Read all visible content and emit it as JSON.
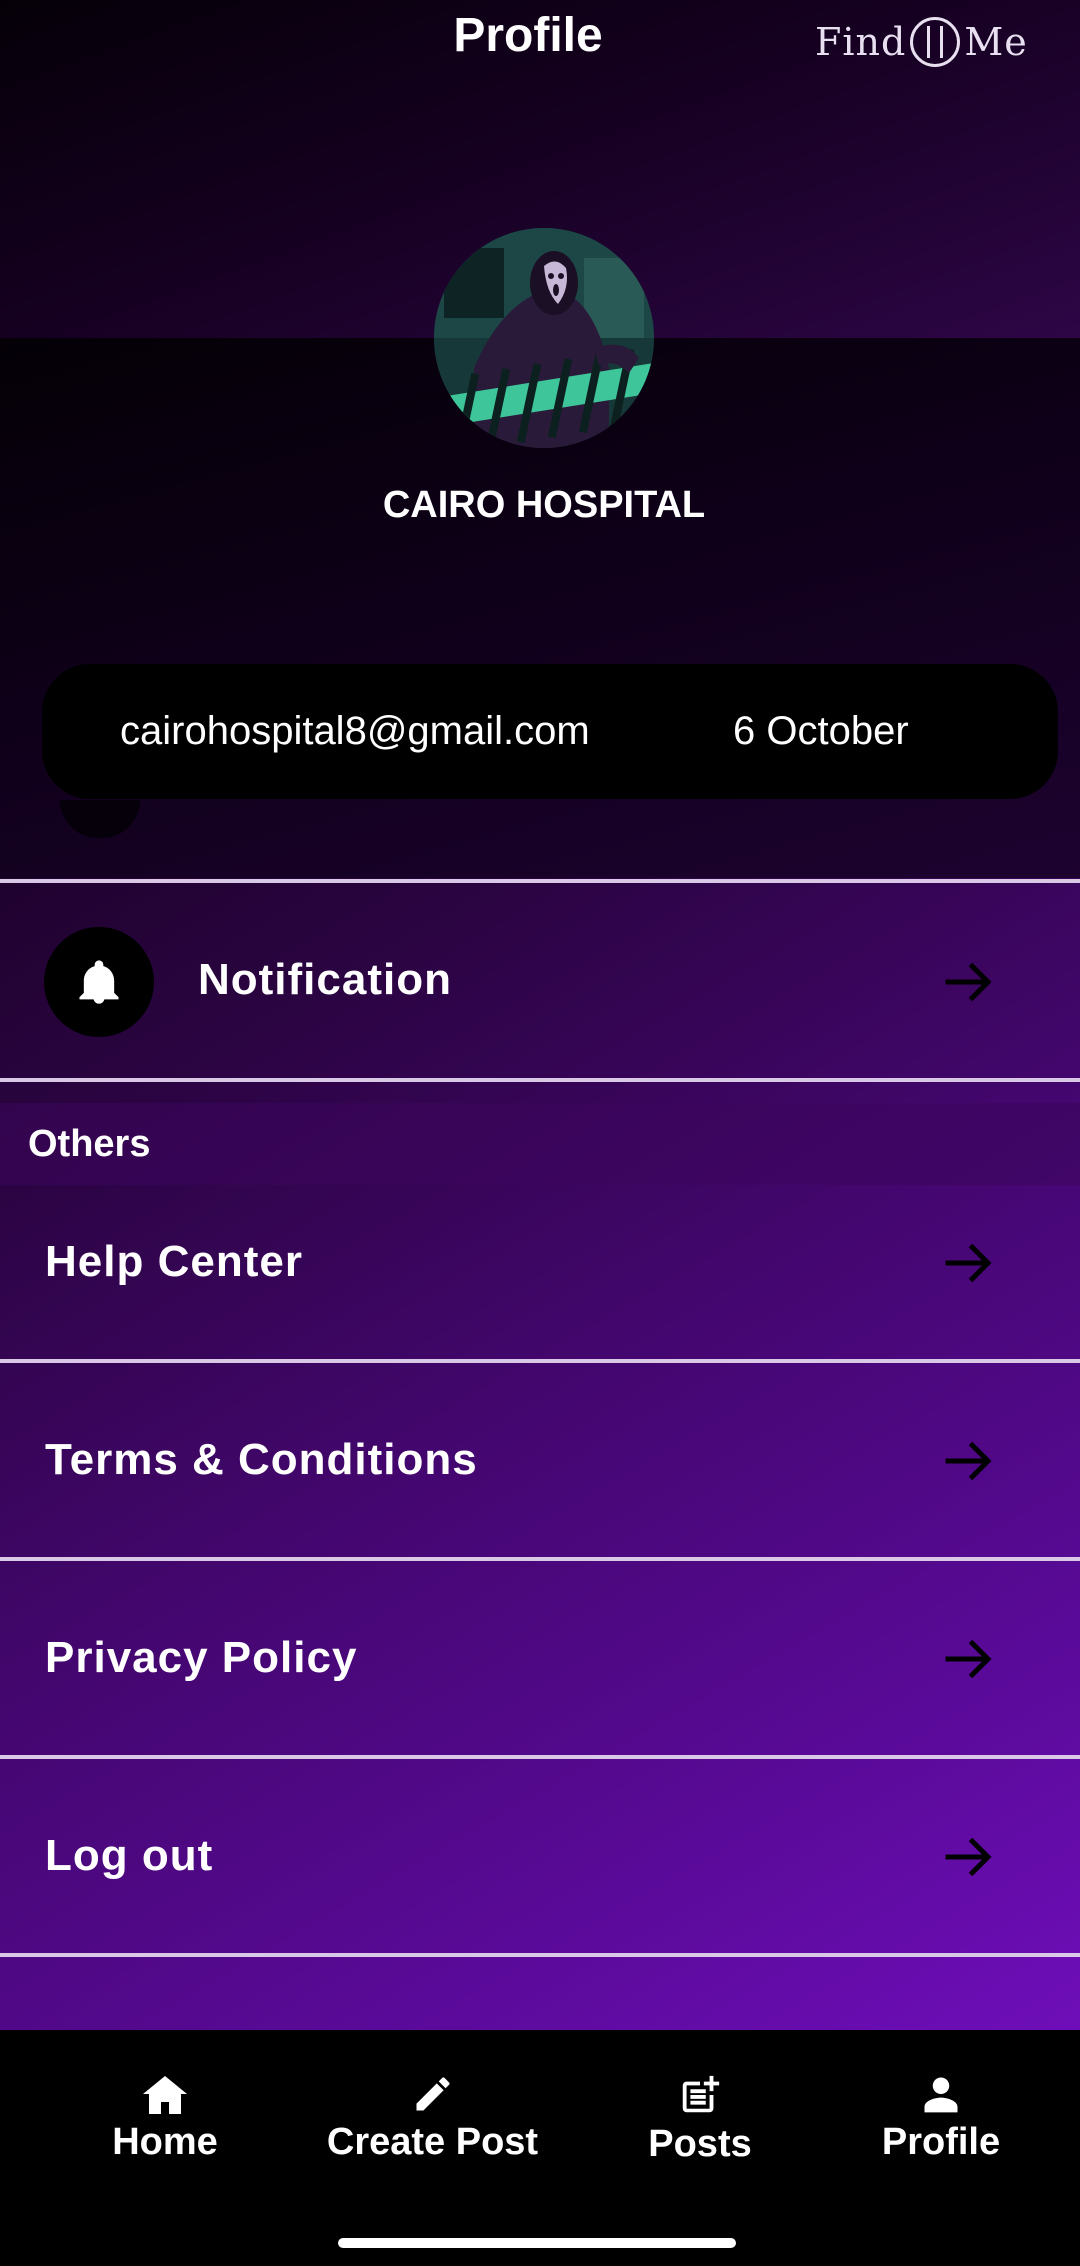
{
  "header": {
    "title": "Profile",
    "logo_text_left": "Find",
    "logo_text_right": "Me"
  },
  "profile": {
    "name": "CAIRO HOSPITAL",
    "email": "cairohospital8@gmail.com",
    "city": "6 October"
  },
  "menu": {
    "notification_label": "Notification",
    "others_title": "Others",
    "items": [
      {
        "label": "Help Center"
      },
      {
        "label": "Terms & Conditions"
      },
      {
        "label": "Privacy Policy"
      },
      {
        "label": "Log out"
      }
    ]
  },
  "bottom_nav": {
    "items": [
      {
        "label": "Home",
        "icon": "home-icon"
      },
      {
        "label": "Create Post",
        "icon": "pencil-icon"
      },
      {
        "label": "Posts",
        "icon": "post-add-icon"
      },
      {
        "label": "Profile",
        "icon": "person-icon"
      }
    ]
  },
  "colors": {
    "accent": "#7a10cc",
    "card_bg": "#000000",
    "divider": "#d9c8e6"
  }
}
